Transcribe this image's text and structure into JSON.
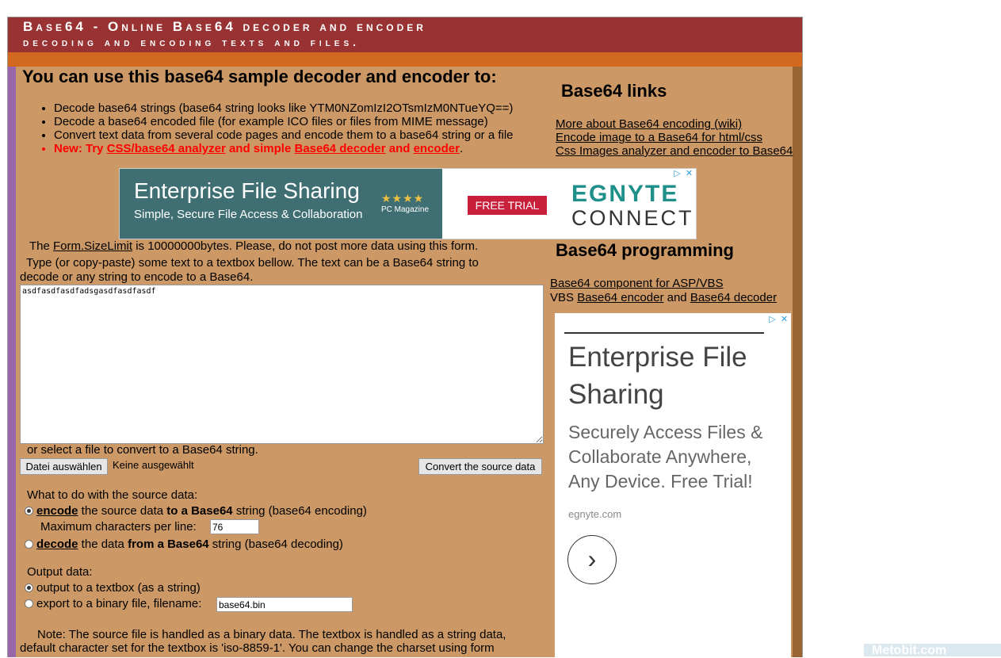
{
  "header": {
    "line1": "Base64 - Online Base64 decoder and encoder",
    "line2": "decoding and encoding texts and files."
  },
  "main": {
    "heading": "You can use this base64 sample decoder and encoder to:",
    "features": [
      "Decode base64 strings (base64 string looks like YTM0NZomIzI2OTsmIzM0NTueYQ==)",
      "Decode a base64 encoded file (for example ICO files or files from MIME message)",
      "Convert text data from several code pages and encode them to a base64 string or a file"
    ],
    "new_prefix": "New: Try ",
    "new_link1": "CSS/base64 analyzer",
    "new_mid": " and simple ",
    "new_link2": "Base64 decoder",
    "new_and": " and ",
    "new_link3": "encoder",
    "new_end": ".",
    "limit_prefix": "The ",
    "limit_link": "Form.SizeLimit",
    "limit_suffix": " is 10000000bytes. Please, do not post more data using this form.",
    "type_hint_1": "Type (or copy-paste) some text to a textbox bellow. The text can be a Base64 string to",
    "type_hint_2": "decode or any string to encode to a Base64.",
    "textbox_value": "asdfasdfasdfadsgasdfasdfasdf",
    "file_hint": "or select a file to convert to a Base64 string.",
    "choose_file_label": "Datei auswählen",
    "no_file_label": "Keine ausgewählt",
    "convert_label": "Convert the source data",
    "what_to_do": "What to do with the source data:",
    "encode_bold": "encode",
    "encode_mid": " the source data ",
    "encode_bold2": "to a Base64",
    "encode_tail": " string (base64 encoding)",
    "max_chars_label": "Maximum characters per line:",
    "max_chars_value": "76",
    "decode_bold": "decode",
    "decode_mid": " the data ",
    "decode_bold2": "from a Base64",
    "decode_tail": " string (base64 decoding)",
    "output_label": "Output data:",
    "output_textbox": "output to a textbox (as a string)",
    "output_file": "export to a binary file, filename:",
    "filename_value": "base64.bin",
    "note_1": "Note: The source file is handled as a binary data. The textbox is handled as a string data,",
    "note_2": "default character set for the textbox is 'iso-8859-1'. You can change the charset using form"
  },
  "ad_top": {
    "headline": "Enterprise File Sharing",
    "subline": "Simple, Secure File Access & Collaboration",
    "stars": "★★★★",
    "rating_source": "PC Magazine",
    "cta": "FREE TRIAL",
    "logo_top": "EGNYTE",
    "logo_bottom": "CONNECT"
  },
  "sidebar": {
    "links_heading": "Base64 links",
    "links": [
      "More about Base64 encoding (wiki)",
      "Encode image to a Base64 for html/css",
      "Css Images analyzer and encoder to Base64"
    ],
    "programming_heading": "Base64 programming",
    "component_link": "Base64 component for ASP/VBS",
    "vbs_prefix": "VBS ",
    "vbs_link1": "Base64 encoder",
    "vbs_and": " and ",
    "vbs_link2": "Base64 decoder"
  },
  "ad_side": {
    "headline": "Enterprise File Sharing",
    "subline": "Securely Access Files & Collaborate Anywhere, Any Device. Free Trial!",
    "domain": "egnyte.com",
    "arrow": "›"
  },
  "watermark": "Metobit.com",
  "colors": {
    "header": "#993333",
    "band": "#d2691e",
    "body": "#cc9966",
    "stripe_left": "#9966aa",
    "stripe_right": "#996633",
    "accent_red": "#ff0000"
  }
}
